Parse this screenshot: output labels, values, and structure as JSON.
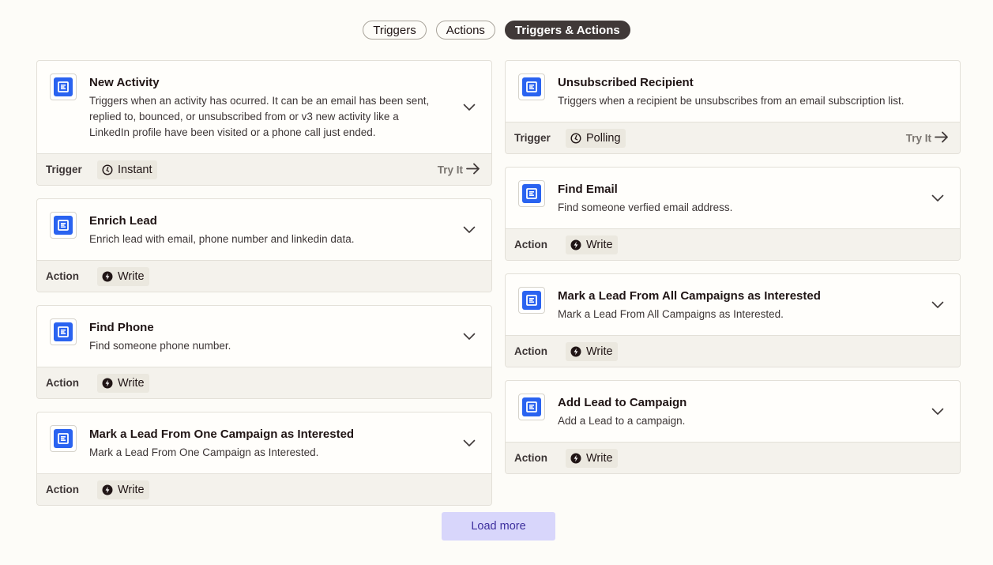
{
  "filters": [
    {
      "label": "Triggers",
      "active": false
    },
    {
      "label": "Actions",
      "active": false
    },
    {
      "label": "Triggers & Actions",
      "active": true
    }
  ],
  "left_cards": [
    {
      "title": "New Activity",
      "description": "Triggers when an activity has ocurred. It can be an email has been sent, replied to, bounced, or unsubscribed from or v3 new activity like a LinkedIn profile have been visited or a phone call just ended.",
      "kind": "Trigger",
      "tag": "Instant",
      "tag_icon": "clock-icon",
      "try_label": "Try It"
    },
    {
      "title": "Enrich Lead",
      "description": "Enrich lead with email, phone number and linkedin data.",
      "kind": "Action",
      "tag": "Write",
      "tag_icon": "bolt-icon"
    },
    {
      "title": "Find Phone",
      "description": "Find someone phone number.",
      "kind": "Action",
      "tag": "Write",
      "tag_icon": "bolt-icon"
    },
    {
      "title": "Mark a Lead From One Campaign as Interested",
      "description": "Mark a Lead From One Campaign as Interested.",
      "kind": "Action",
      "tag": "Write",
      "tag_icon": "bolt-icon"
    }
  ],
  "right_cards": [
    {
      "title": "Unsubscribed Recipient",
      "description": "Triggers when a recipient be unsubscribes from an email subscription list.",
      "kind": "Trigger",
      "tag": "Polling",
      "tag_icon": "clock-icon",
      "try_label": "Try It",
      "no_chevron": true
    },
    {
      "title": "Find Email",
      "description": "Find someone verfied email address.",
      "kind": "Action",
      "tag": "Write",
      "tag_icon": "bolt-icon"
    },
    {
      "title": "Mark a Lead From All Campaigns as Interested",
      "description": "Mark a Lead From All Campaigns as Interested.",
      "kind": "Action",
      "tag": "Write",
      "tag_icon": "bolt-icon"
    },
    {
      "title": "Add Lead to Campaign",
      "description": "Add a Lead to a campaign.",
      "kind": "Action",
      "tag": "Write",
      "tag_icon": "bolt-icon"
    }
  ],
  "load_more_label": "Load more",
  "colors": {
    "accent": "#2a63f0",
    "active_pill": "#403938",
    "load_more_bg": "#d8d6fb"
  }
}
